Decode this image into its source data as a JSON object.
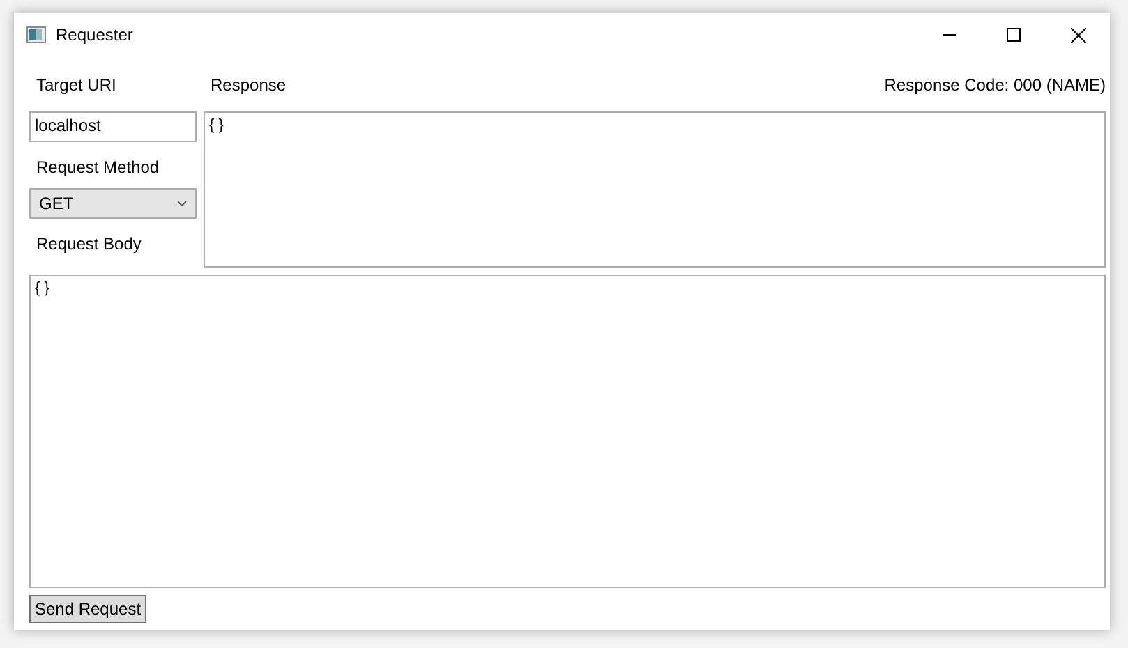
{
  "window": {
    "title": "Requester"
  },
  "target_uri": {
    "label": "Target URI",
    "value": "localhost"
  },
  "request_method": {
    "label": "Request Method",
    "value": "GET"
  },
  "request_body": {
    "label": "Request Body",
    "value": "{ }"
  },
  "response": {
    "label": "Response",
    "code": "Response Code: 000 (NAME)",
    "value": "{ }"
  },
  "buttons": [
    "Send Request"
  ]
}
